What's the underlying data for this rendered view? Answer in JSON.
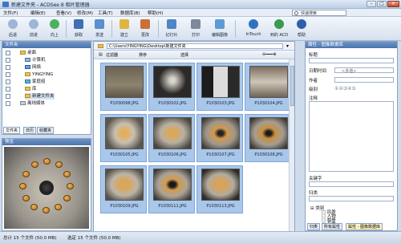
{
  "window": {
    "title": "新建文件夹 - ACDSee 8 相片管理器"
  },
  "menu": {
    "items": [
      "文件(F)",
      "编辑(E)",
      "查看(V)",
      "修改(M)",
      "工具(T)",
      "数据库(B)",
      "帮助(H)"
    ],
    "search_label": "快速搜索"
  },
  "toolbar": {
    "buttons": [
      "后退",
      "前进",
      "向上",
      "获取",
      "发送",
      "建立",
      "更改",
      "幻灯片",
      "打印",
      "编辑图像",
      "InTouch",
      "到的 ACD",
      "帮助"
    ]
  },
  "folders": {
    "header": "文件夹",
    "items": [
      "桌面",
      "计算机",
      "网络",
      "YINGYING",
      "家庭组",
      "库",
      "新建文件夹",
      "离线媒体"
    ]
  },
  "left_tabs": [
    "文件夹",
    "日历",
    "收藏夹"
  ],
  "preview": {
    "header": "预览"
  },
  "pathbar": {
    "path": "C:\\Users\\YINGYING\\Desktop\\新建文件夹"
  },
  "filterbar": {
    "filter": "过滤器",
    "sort": "排序",
    "select": "选择"
  },
  "thumbnails": [
    "P1030098.JPG",
    "P1030102.JPG",
    "P1030103.JPG",
    "P1030104.JPG",
    "P1030105.JPG",
    "P1030106.JPG",
    "P1030107.JPG",
    "P1030108.JPG",
    "P1030109.JPG",
    "P1030111.JPG",
    "P1030113.JPG"
  ],
  "properties": {
    "header": "属性 - 图像数据库",
    "fields": [
      "标题",
      "日期时间",
      "作者",
      "级别",
      "注释",
      "关键字",
      "归类"
    ],
    "date_placeholder": "<多值>",
    "categories_root": "类别",
    "categories": [
      "风景",
      "人物",
      "相册",
      "杂类"
    ],
    "tabs": [
      "归类",
      "所有属性",
      "属性 - 图像数据库"
    ]
  },
  "status": {
    "total": "总计 15 个文件 (50.0 MB)",
    "selected": "选定 15 个文件 (50.0 MB)"
  },
  "colors": {
    "selected_thumb": "#a9c7ea",
    "pane_header": "#4a74ad"
  }
}
